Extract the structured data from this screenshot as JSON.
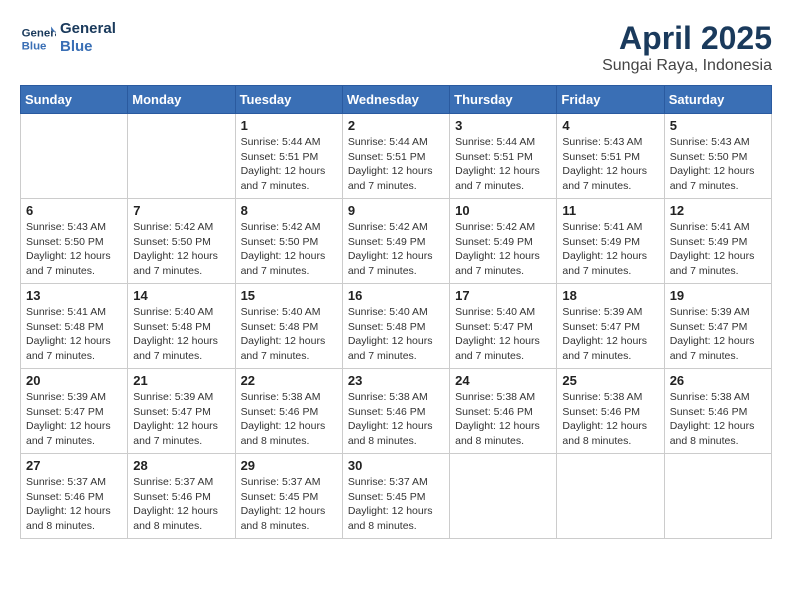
{
  "header": {
    "logo_line1": "General",
    "logo_line2": "Blue",
    "month_year": "April 2025",
    "location": "Sungai Raya, Indonesia"
  },
  "days_of_week": [
    "Sunday",
    "Monday",
    "Tuesday",
    "Wednesday",
    "Thursday",
    "Friday",
    "Saturday"
  ],
  "weeks": [
    [
      {
        "day": "",
        "info": ""
      },
      {
        "day": "",
        "info": ""
      },
      {
        "day": "1",
        "info": "Sunrise: 5:44 AM\nSunset: 5:51 PM\nDaylight: 12 hours\nand 7 minutes."
      },
      {
        "day": "2",
        "info": "Sunrise: 5:44 AM\nSunset: 5:51 PM\nDaylight: 12 hours\nand 7 minutes."
      },
      {
        "day": "3",
        "info": "Sunrise: 5:44 AM\nSunset: 5:51 PM\nDaylight: 12 hours\nand 7 minutes."
      },
      {
        "day": "4",
        "info": "Sunrise: 5:43 AM\nSunset: 5:51 PM\nDaylight: 12 hours\nand 7 minutes."
      },
      {
        "day": "5",
        "info": "Sunrise: 5:43 AM\nSunset: 5:50 PM\nDaylight: 12 hours\nand 7 minutes."
      }
    ],
    [
      {
        "day": "6",
        "info": "Sunrise: 5:43 AM\nSunset: 5:50 PM\nDaylight: 12 hours\nand 7 minutes."
      },
      {
        "day": "7",
        "info": "Sunrise: 5:42 AM\nSunset: 5:50 PM\nDaylight: 12 hours\nand 7 minutes."
      },
      {
        "day": "8",
        "info": "Sunrise: 5:42 AM\nSunset: 5:50 PM\nDaylight: 12 hours\nand 7 minutes."
      },
      {
        "day": "9",
        "info": "Sunrise: 5:42 AM\nSunset: 5:49 PM\nDaylight: 12 hours\nand 7 minutes."
      },
      {
        "day": "10",
        "info": "Sunrise: 5:42 AM\nSunset: 5:49 PM\nDaylight: 12 hours\nand 7 minutes."
      },
      {
        "day": "11",
        "info": "Sunrise: 5:41 AM\nSunset: 5:49 PM\nDaylight: 12 hours\nand 7 minutes."
      },
      {
        "day": "12",
        "info": "Sunrise: 5:41 AM\nSunset: 5:49 PM\nDaylight: 12 hours\nand 7 minutes."
      }
    ],
    [
      {
        "day": "13",
        "info": "Sunrise: 5:41 AM\nSunset: 5:48 PM\nDaylight: 12 hours\nand 7 minutes."
      },
      {
        "day": "14",
        "info": "Sunrise: 5:40 AM\nSunset: 5:48 PM\nDaylight: 12 hours\nand 7 minutes."
      },
      {
        "day": "15",
        "info": "Sunrise: 5:40 AM\nSunset: 5:48 PM\nDaylight: 12 hours\nand 7 minutes."
      },
      {
        "day": "16",
        "info": "Sunrise: 5:40 AM\nSunset: 5:48 PM\nDaylight: 12 hours\nand 7 minutes."
      },
      {
        "day": "17",
        "info": "Sunrise: 5:40 AM\nSunset: 5:47 PM\nDaylight: 12 hours\nand 7 minutes."
      },
      {
        "day": "18",
        "info": "Sunrise: 5:39 AM\nSunset: 5:47 PM\nDaylight: 12 hours\nand 7 minutes."
      },
      {
        "day": "19",
        "info": "Sunrise: 5:39 AM\nSunset: 5:47 PM\nDaylight: 12 hours\nand 7 minutes."
      }
    ],
    [
      {
        "day": "20",
        "info": "Sunrise: 5:39 AM\nSunset: 5:47 PM\nDaylight: 12 hours\nand 7 minutes."
      },
      {
        "day": "21",
        "info": "Sunrise: 5:39 AM\nSunset: 5:47 PM\nDaylight: 12 hours\nand 7 minutes."
      },
      {
        "day": "22",
        "info": "Sunrise: 5:38 AM\nSunset: 5:46 PM\nDaylight: 12 hours\nand 8 minutes."
      },
      {
        "day": "23",
        "info": "Sunrise: 5:38 AM\nSunset: 5:46 PM\nDaylight: 12 hours\nand 8 minutes."
      },
      {
        "day": "24",
        "info": "Sunrise: 5:38 AM\nSunset: 5:46 PM\nDaylight: 12 hours\nand 8 minutes."
      },
      {
        "day": "25",
        "info": "Sunrise: 5:38 AM\nSunset: 5:46 PM\nDaylight: 12 hours\nand 8 minutes."
      },
      {
        "day": "26",
        "info": "Sunrise: 5:38 AM\nSunset: 5:46 PM\nDaylight: 12 hours\nand 8 minutes."
      }
    ],
    [
      {
        "day": "27",
        "info": "Sunrise: 5:37 AM\nSunset: 5:46 PM\nDaylight: 12 hours\nand 8 minutes."
      },
      {
        "day": "28",
        "info": "Sunrise: 5:37 AM\nSunset: 5:46 PM\nDaylight: 12 hours\nand 8 minutes."
      },
      {
        "day": "29",
        "info": "Sunrise: 5:37 AM\nSunset: 5:45 PM\nDaylight: 12 hours\nand 8 minutes."
      },
      {
        "day": "30",
        "info": "Sunrise: 5:37 AM\nSunset: 5:45 PM\nDaylight: 12 hours\nand 8 minutes."
      },
      {
        "day": "",
        "info": ""
      },
      {
        "day": "",
        "info": ""
      },
      {
        "day": "",
        "info": ""
      }
    ]
  ]
}
